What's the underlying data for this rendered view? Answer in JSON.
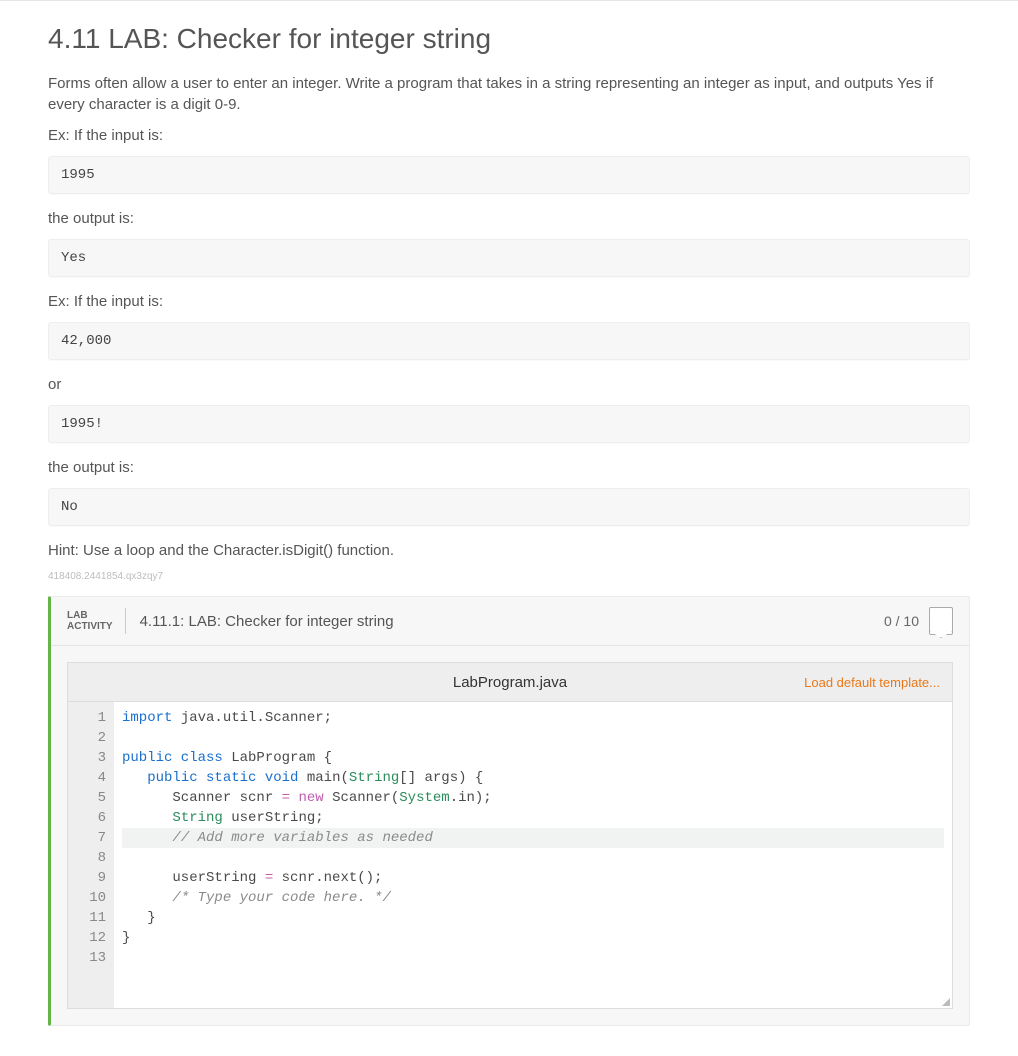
{
  "page": {
    "title": "4.11 LAB: Checker for integer string",
    "intro": "Forms often allow a user to enter an integer. Write a program that takes in a string representing an integer as input, and outputs Yes if every character is a digit 0-9.",
    "ex1_label": "Ex: If the input is:",
    "sample1": "1995",
    "out_label1": "the output is:",
    "sample2": "Yes",
    "ex2_label": "Ex: If the input is:",
    "sample3": "42,000",
    "or_label": "or",
    "sample4": "1995!",
    "out_label2": "the output is:",
    "sample5": "No",
    "hint": "Hint: Use a loop and the Character.isDigit() function.",
    "footnote": "418408.2441854.qx3zqy7"
  },
  "lab": {
    "badge_line1": "LAB",
    "badge_line2": "ACTIVITY",
    "title": "4.11.1: LAB: Checker for integer string",
    "score": "0 / 10",
    "file_name": "LabProgram.java",
    "load_template": "Load default template..."
  },
  "code": {
    "gutter": [
      "1",
      "2",
      "3",
      "4",
      "5",
      "6",
      "7",
      "8",
      "9",
      "10",
      "11",
      "12",
      "13"
    ],
    "lines": [
      {
        "tokens": [
          {
            "t": "import ",
            "c": "tok-kw"
          },
          {
            "t": "java.util.Scanner;",
            "c": ""
          }
        ]
      },
      {
        "tokens": [
          {
            "t": "",
            "c": ""
          }
        ]
      },
      {
        "tokens": [
          {
            "t": "public class ",
            "c": "tok-kw"
          },
          {
            "t": "LabProgram {",
            "c": ""
          }
        ]
      },
      {
        "tokens": [
          {
            "t": "   ",
            "c": ""
          },
          {
            "t": "public static void ",
            "c": "tok-kw"
          },
          {
            "t": "main(",
            "c": ""
          },
          {
            "t": "String",
            "c": "tok-type"
          },
          {
            "t": "[] args) {",
            "c": ""
          }
        ]
      },
      {
        "tokens": [
          {
            "t": "      Scanner scnr ",
            "c": ""
          },
          {
            "t": "= new ",
            "c": "tok-op"
          },
          {
            "t": "Scanner(",
            "c": ""
          },
          {
            "t": "System",
            "c": "tok-type"
          },
          {
            "t": ".in);",
            "c": ""
          }
        ]
      },
      {
        "tokens": [
          {
            "t": "      ",
            "c": ""
          },
          {
            "t": "String ",
            "c": "tok-type"
          },
          {
            "t": "userString;",
            "c": ""
          }
        ]
      },
      {
        "hl": true,
        "tokens": [
          {
            "t": "      ",
            "c": ""
          },
          {
            "t": "// Add more variables as needed",
            "c": "tok-cmt"
          }
        ]
      },
      {
        "tokens": [
          {
            "t": "",
            "c": ""
          }
        ]
      },
      {
        "tokens": [
          {
            "t": "      userString ",
            "c": ""
          },
          {
            "t": "= ",
            "c": "tok-op"
          },
          {
            "t": "scnr.next();",
            "c": ""
          }
        ]
      },
      {
        "tokens": [
          {
            "t": "      ",
            "c": ""
          },
          {
            "t": "/* Type your code here. */",
            "c": "tok-cmt"
          }
        ]
      },
      {
        "tokens": [
          {
            "t": "   }",
            "c": ""
          }
        ]
      },
      {
        "tokens": [
          {
            "t": "}",
            "c": ""
          }
        ]
      },
      {
        "tokens": [
          {
            "t": "",
            "c": ""
          }
        ]
      }
    ]
  }
}
